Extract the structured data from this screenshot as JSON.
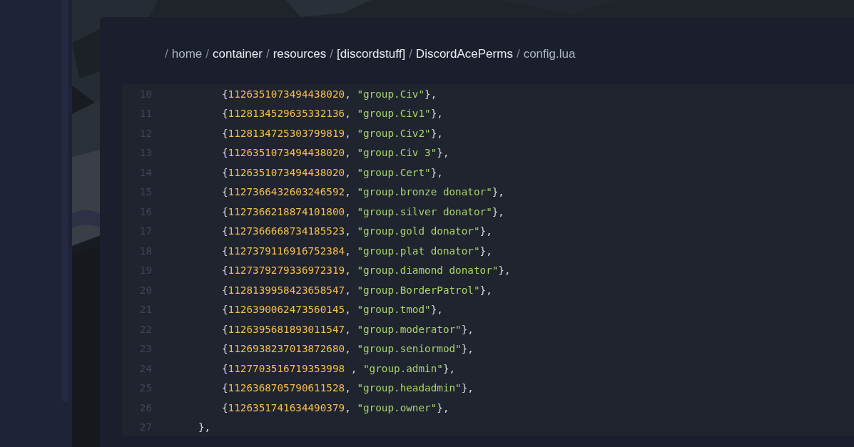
{
  "breadcrumb": [
    {
      "kind": "sep",
      "text": "/"
    },
    {
      "kind": "crumb",
      "text": "home",
      "bold": false
    },
    {
      "kind": "sep",
      "text": "/"
    },
    {
      "kind": "crumb",
      "text": "container",
      "bold": true
    },
    {
      "kind": "sep",
      "text": "/"
    },
    {
      "kind": "crumb",
      "text": "resources",
      "bold": true
    },
    {
      "kind": "sep",
      "text": "/"
    },
    {
      "kind": "crumb",
      "text": "[discordstuff]",
      "bold": true
    },
    {
      "kind": "sep",
      "text": "/"
    },
    {
      "kind": "crumb",
      "text": "DiscordAcePerms",
      "bold": true
    },
    {
      "kind": "sep",
      "text": "/"
    },
    {
      "kind": "crumb",
      "text": "config.lua",
      "bold": false
    }
  ],
  "code_lines": [
    {
      "number": "10",
      "kind": "entry",
      "tokens": [
        {
          "kind": "punct",
          "text": "{"
        },
        {
          "kind": "num",
          "text": "1126351073494438020"
        },
        {
          "kind": "punct",
          "text": ", "
        },
        {
          "kind": "str",
          "text": "\"group.Civ\""
        },
        {
          "kind": "punct",
          "text": "},"
        }
      ]
    },
    {
      "number": "11",
      "kind": "entry",
      "tokens": [
        {
          "kind": "punct",
          "text": "{"
        },
        {
          "kind": "num",
          "text": "1128134529635332136"
        },
        {
          "kind": "punct",
          "text": ", "
        },
        {
          "kind": "str",
          "text": "\"group.Civ1\""
        },
        {
          "kind": "punct",
          "text": "},"
        }
      ]
    },
    {
      "number": "12",
      "kind": "entry",
      "tokens": [
        {
          "kind": "punct",
          "text": "{"
        },
        {
          "kind": "num",
          "text": "1128134725303799819"
        },
        {
          "kind": "punct",
          "text": ", "
        },
        {
          "kind": "str",
          "text": "\"group.Civ2\""
        },
        {
          "kind": "punct",
          "text": "},"
        }
      ]
    },
    {
      "number": "13",
      "kind": "entry",
      "tokens": [
        {
          "kind": "punct",
          "text": "{"
        },
        {
          "kind": "num",
          "text": "1126351073494438020"
        },
        {
          "kind": "punct",
          "text": ", "
        },
        {
          "kind": "str",
          "text": "\"group.Civ 3\""
        },
        {
          "kind": "punct",
          "text": "},"
        }
      ]
    },
    {
      "number": "14",
      "kind": "entry",
      "tokens": [
        {
          "kind": "punct",
          "text": "{"
        },
        {
          "kind": "num",
          "text": "1126351073494438020"
        },
        {
          "kind": "punct",
          "text": ", "
        },
        {
          "kind": "str",
          "text": "\"group.Cert\""
        },
        {
          "kind": "punct",
          "text": "},"
        }
      ]
    },
    {
      "number": "15",
      "kind": "entry",
      "tokens": [
        {
          "kind": "punct",
          "text": "{"
        },
        {
          "kind": "num",
          "text": "1127366432603246592"
        },
        {
          "kind": "punct",
          "text": ", "
        },
        {
          "kind": "str",
          "text": "\"group.bronze donator\""
        },
        {
          "kind": "punct",
          "text": "},"
        }
      ]
    },
    {
      "number": "16",
      "kind": "entry",
      "tokens": [
        {
          "kind": "punct",
          "text": "{"
        },
        {
          "kind": "num",
          "text": "1127366218874101800"
        },
        {
          "kind": "punct",
          "text": ", "
        },
        {
          "kind": "str",
          "text": "\"group.silver donator\""
        },
        {
          "kind": "punct",
          "text": "},"
        }
      ]
    },
    {
      "number": "17",
      "kind": "entry",
      "tokens": [
        {
          "kind": "punct",
          "text": "{"
        },
        {
          "kind": "num",
          "text": "1127366668734185523"
        },
        {
          "kind": "punct",
          "text": ", "
        },
        {
          "kind": "str",
          "text": "\"group.gold donator\""
        },
        {
          "kind": "punct",
          "text": "},"
        }
      ]
    },
    {
      "number": "18",
      "kind": "entry",
      "tokens": [
        {
          "kind": "punct",
          "text": "{"
        },
        {
          "kind": "num",
          "text": "1127379116916752384"
        },
        {
          "kind": "punct",
          "text": ", "
        },
        {
          "kind": "str",
          "text": "\"group.plat donator\""
        },
        {
          "kind": "punct",
          "text": "},"
        }
      ]
    },
    {
      "number": "19",
      "kind": "entry",
      "tokens": [
        {
          "kind": "punct",
          "text": "{"
        },
        {
          "kind": "num",
          "text": "1127379279336972319"
        },
        {
          "kind": "punct",
          "text": ", "
        },
        {
          "kind": "str",
          "text": "\"group.diamond donator\""
        },
        {
          "kind": "punct",
          "text": "},"
        }
      ]
    },
    {
      "number": "20",
      "kind": "entry",
      "tokens": [
        {
          "kind": "punct",
          "text": "{"
        },
        {
          "kind": "num",
          "text": "1128139958423658547"
        },
        {
          "kind": "punct",
          "text": ", "
        },
        {
          "kind": "str",
          "text": "\"group.BorderPatrol\""
        },
        {
          "kind": "punct",
          "text": "},"
        }
      ]
    },
    {
      "number": "21",
      "kind": "entry",
      "tokens": [
        {
          "kind": "punct",
          "text": "{"
        },
        {
          "kind": "num",
          "text": "1126390062473560145"
        },
        {
          "kind": "punct",
          "text": ", "
        },
        {
          "kind": "str",
          "text": "\"group.tmod\""
        },
        {
          "kind": "punct",
          "text": "},"
        }
      ]
    },
    {
      "number": "22",
      "kind": "entry",
      "tokens": [
        {
          "kind": "punct",
          "text": "{"
        },
        {
          "kind": "num",
          "text": "1126395681893011547"
        },
        {
          "kind": "punct",
          "text": ", "
        },
        {
          "kind": "str",
          "text": "\"group.moderator\""
        },
        {
          "kind": "punct",
          "text": "},"
        }
      ]
    },
    {
      "number": "23",
      "kind": "entry",
      "tokens": [
        {
          "kind": "punct",
          "text": "{"
        },
        {
          "kind": "num",
          "text": "1126938237013872680"
        },
        {
          "kind": "punct",
          "text": ", "
        },
        {
          "kind": "str",
          "text": "\"group.seniormod\""
        },
        {
          "kind": "punct",
          "text": "},"
        }
      ]
    },
    {
      "number": "24",
      "kind": "entry",
      "tokens": [
        {
          "kind": "punct",
          "text": "{"
        },
        {
          "kind": "num",
          "text": "1127703516719353998"
        },
        {
          "kind": "punct",
          "text": " , "
        },
        {
          "kind": "str",
          "text": "\"group.admin\""
        },
        {
          "kind": "punct",
          "text": "},"
        }
      ]
    },
    {
      "number": "25",
      "kind": "entry",
      "tokens": [
        {
          "kind": "punct",
          "text": "{"
        },
        {
          "kind": "num",
          "text": "1126368705790611528"
        },
        {
          "kind": "punct",
          "text": ", "
        },
        {
          "kind": "str",
          "text": "\"group.headadmin\""
        },
        {
          "kind": "punct",
          "text": "},"
        }
      ]
    },
    {
      "number": "26",
      "kind": "entry",
      "tokens": [
        {
          "kind": "punct",
          "text": "{"
        },
        {
          "kind": "num",
          "text": "1126351741634490379"
        },
        {
          "kind": "punct",
          "text": ", "
        },
        {
          "kind": "str",
          "text": "\"group.owner\""
        },
        {
          "kind": "punct",
          "text": "},"
        }
      ]
    },
    {
      "number": "27",
      "kind": "close",
      "tokens": [
        {
          "kind": "punct",
          "text": "},"
        }
      ]
    }
  ]
}
